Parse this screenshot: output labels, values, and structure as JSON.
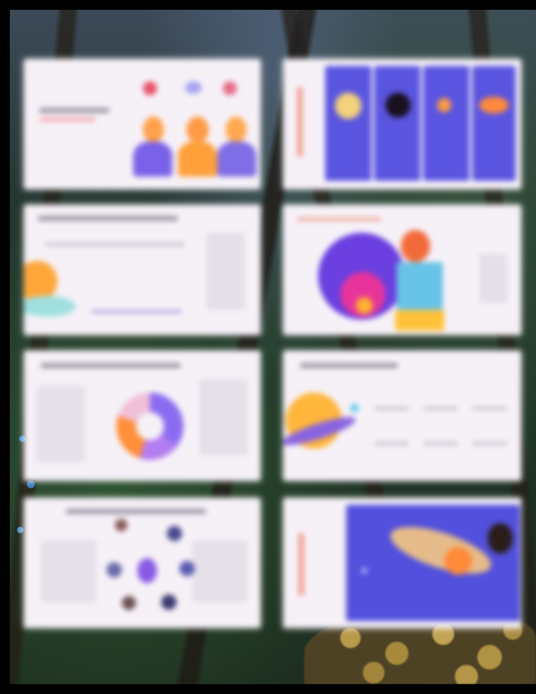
{
  "scene": {
    "background": "forest-night-illustration",
    "content": "blurred-slide-thumbnail-grid"
  },
  "colors": {
    "card_background": "#f6f1f7",
    "accent_purple": "#5a55e0",
    "accent_orange": "#ff9b3d",
    "accent_pink": "#e8349a",
    "text_placeholder": "#c9c3cf"
  },
  "thumbnails": [
    {
      "id": "slide-1",
      "theme": "people-avatars"
    },
    {
      "id": "slide-2",
      "theme": "purple-columns-planets"
    },
    {
      "id": "slide-3",
      "theme": "timeline-sun"
    },
    {
      "id": "slide-4",
      "theme": "circle-astronaut"
    },
    {
      "id": "slide-5",
      "theme": "donut-chart"
    },
    {
      "id": "slide-6",
      "theme": "planet-table"
    },
    {
      "id": "slide-7",
      "theme": "planet-cycle"
    },
    {
      "id": "slide-8",
      "theme": "purple-space-scene"
    }
  ]
}
